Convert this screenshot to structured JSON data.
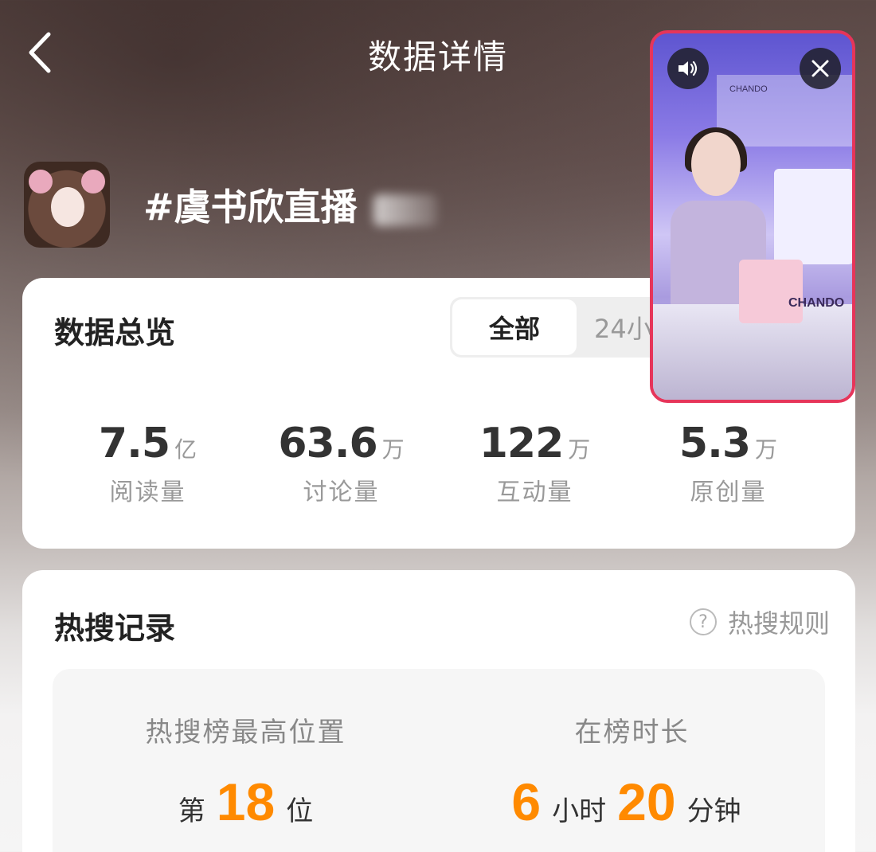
{
  "header": {
    "title": "数据详情"
  },
  "topic": {
    "title": "#虞书欣直播"
  },
  "overview": {
    "title": "数据总览",
    "tabs": [
      "全部",
      "24小"
    ],
    "stats": [
      {
        "value": "7.5",
        "unit": "亿",
        "label": "阅读量"
      },
      {
        "value": "63.6",
        "unit": "万",
        "label": "讨论量"
      },
      {
        "value": "122",
        "unit": "万",
        "label": "互动量"
      },
      {
        "value": "5.3",
        "unit": "万",
        "label": "原创量"
      }
    ]
  },
  "hot": {
    "title": "热搜记录",
    "rules_label": "热搜规则",
    "best_position_label": "热搜榜最高位置",
    "best_position_prefix": "第",
    "best_position_value": "18",
    "best_position_suffix": "位",
    "duration_label": "在榜时长",
    "duration_hours": "6",
    "duration_hours_unit": "小时",
    "duration_minutes": "20",
    "duration_minutes_unit": "分钟"
  },
  "pip": {
    "brand": "CHANDO",
    "brand_top": "CHANDO",
    "accent_color": "#e6355a"
  },
  "colors": {
    "highlight": "#ff8a00"
  }
}
